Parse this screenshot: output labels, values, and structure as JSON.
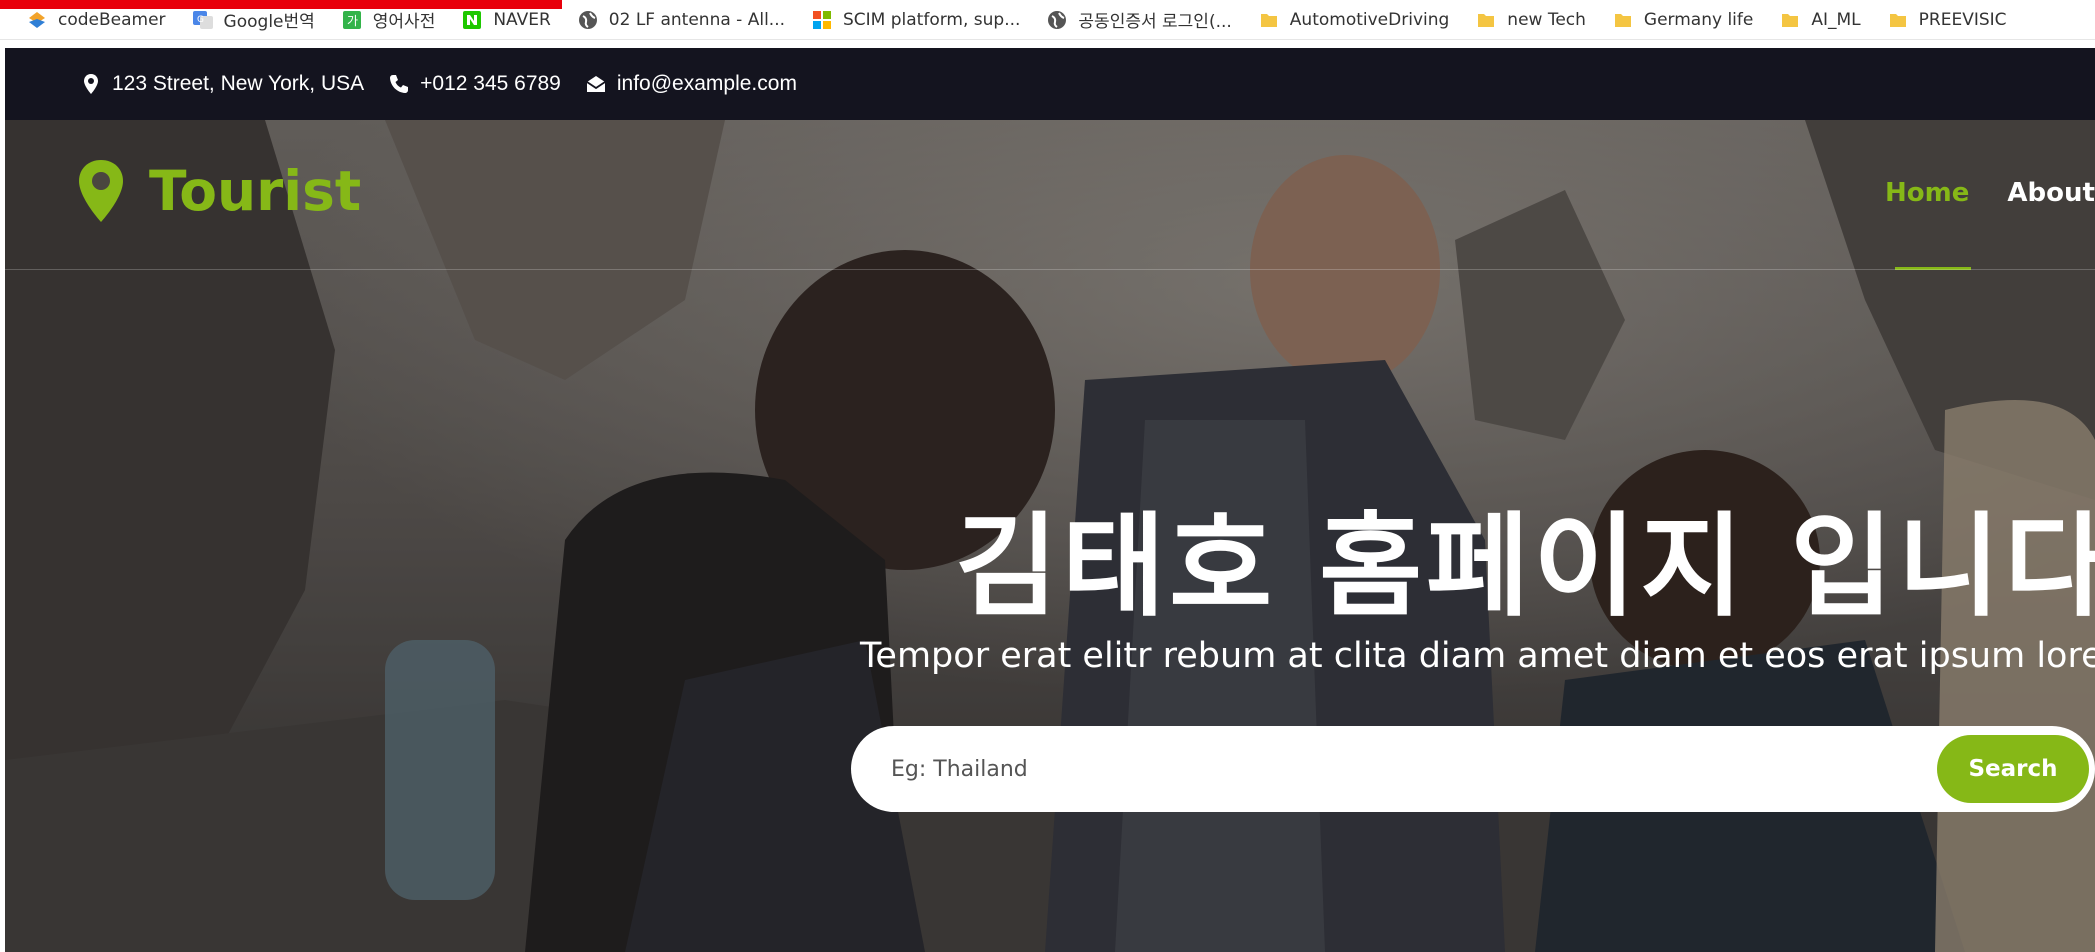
{
  "bookmarks": [
    {
      "label": "codeBeamer",
      "icon": "codebeamer-icon"
    },
    {
      "label": "Google번역",
      "icon": "google-translate-icon"
    },
    {
      "label": "영어사전",
      "icon": "dictionary-icon"
    },
    {
      "label": "NAVER",
      "icon": "naver-icon"
    },
    {
      "label": "02 LF antenna - All...",
      "icon": "globe-icon"
    },
    {
      "label": "SCIM platform, sup...",
      "icon": "microsoft-icon"
    },
    {
      "label": "공동인증서 로그인(...",
      "icon": "globe-icon"
    },
    {
      "label": "AutomotiveDriving",
      "icon": "folder-icon"
    },
    {
      "label": "new Tech",
      "icon": "folder-icon"
    },
    {
      "label": "Germany life",
      "icon": "folder-icon"
    },
    {
      "label": "AI_ML",
      "icon": "folder-icon"
    },
    {
      "label": "PREEVISIC",
      "icon": "folder-icon"
    }
  ],
  "topbar": {
    "address": "123 Street, New York, USA",
    "phone": "+012 345 6789",
    "email": "info@example.com"
  },
  "brand": {
    "name": "Tourist"
  },
  "nav": {
    "items": [
      "Home",
      "About"
    ],
    "active": "Home"
  },
  "hero": {
    "title": "김태호 홈페이지 입니다",
    "subtitle": "Tempor erat elitr rebum at clita diam amet diam et eos erat ipsum lorem sit",
    "search_placeholder": "Eg: Thailand",
    "search_button": "Search"
  },
  "colors": {
    "accent": "#86b817",
    "topbar_bg": "#14141f",
    "marker_red": "#e8000b"
  }
}
